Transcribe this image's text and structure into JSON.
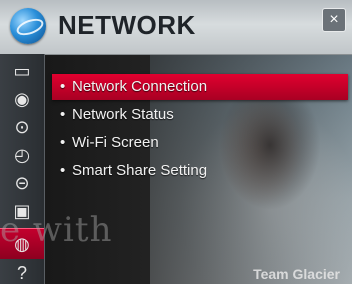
{
  "header": {
    "title": "NETWORK",
    "close_symbol": "×"
  },
  "sidebar": {
    "items": [
      {
        "name": "picture-icon",
        "glyph": "▭"
      },
      {
        "name": "audio-icon",
        "glyph": "◉"
      },
      {
        "name": "channel-icon",
        "glyph": "⊙"
      },
      {
        "name": "time-icon",
        "glyph": "◴"
      },
      {
        "name": "lock-icon",
        "glyph": "⊝"
      },
      {
        "name": "option-icon",
        "glyph": "▣"
      },
      {
        "name": "network-icon",
        "glyph": "◍"
      },
      {
        "name": "help-icon",
        "glyph": "?"
      }
    ]
  },
  "menu": {
    "items": [
      {
        "label": "Network Connection",
        "selected": true
      },
      {
        "label": "Network Status",
        "selected": false
      },
      {
        "label": "Wi-Fi Screen",
        "selected": false
      },
      {
        "label": "Smart Share Setting",
        "selected": false
      }
    ],
    "bullet": "•"
  },
  "overlay": {
    "watermark": "e with",
    "caption": "Team Glacier"
  },
  "colors": {
    "accent": "#d1002a"
  }
}
